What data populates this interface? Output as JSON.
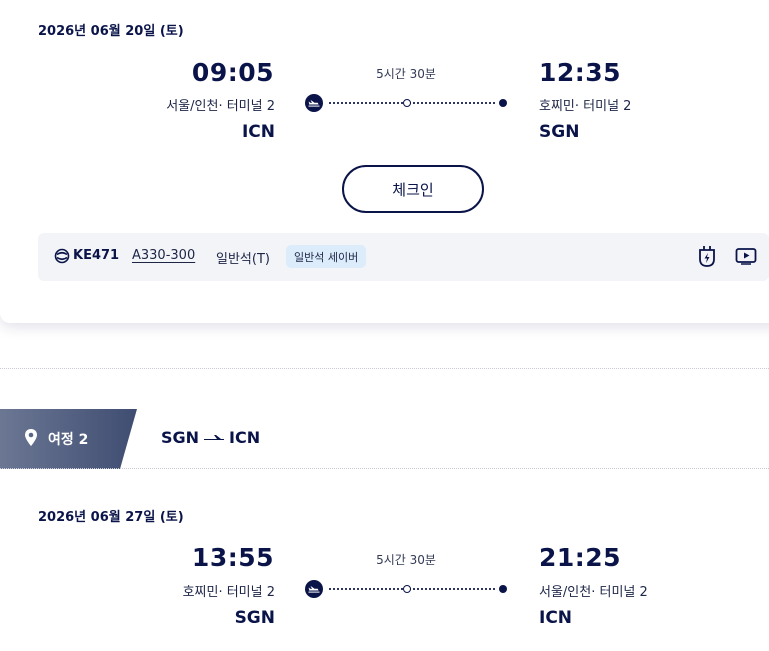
{
  "segment1": {
    "date": "2026년 06월 20일 (토)",
    "departure_time": "09:05",
    "arrival_time": "12:35",
    "departure_city": "서울/인천· 터미널  2",
    "arrival_city": "호찌민· 터미널  2",
    "departure_code": "ICN",
    "arrival_code": "SGN",
    "duration": "5시간 30분",
    "checkin_label": "체크인",
    "flight_number": "KE471",
    "aircraft": "A330-300",
    "cabin": "일반석(T)",
    "fare_badge": "일반석 세이버"
  },
  "segment2_header": {
    "label": "여정 2",
    "from": "SGN",
    "to": "ICN"
  },
  "segment2": {
    "date": "2026년 06월 27일 (토)",
    "departure_time": "13:55",
    "arrival_time": "21:25",
    "departure_city": "호찌민· 터미널  2",
    "arrival_city": "서울/인천· 터미널  2",
    "departure_code": "SGN",
    "arrival_code": "ICN",
    "duration": "5시간 30분"
  },
  "icons": {
    "takeoff": "plane-takeoff-icon",
    "airline": "korean-air-logo-icon",
    "power": "power-outlet-icon",
    "video": "video-play-icon",
    "location": "location-pin-icon",
    "route_arrow": "plane-arrow-icon"
  },
  "colors": {
    "navy": "#0a1449",
    "tab_gradient_start": "#6b7793",
    "tab_gradient_end": "#3f4d72",
    "badge_bg": "#dcecfb",
    "info_bar_bg": "#f3f4f7"
  }
}
